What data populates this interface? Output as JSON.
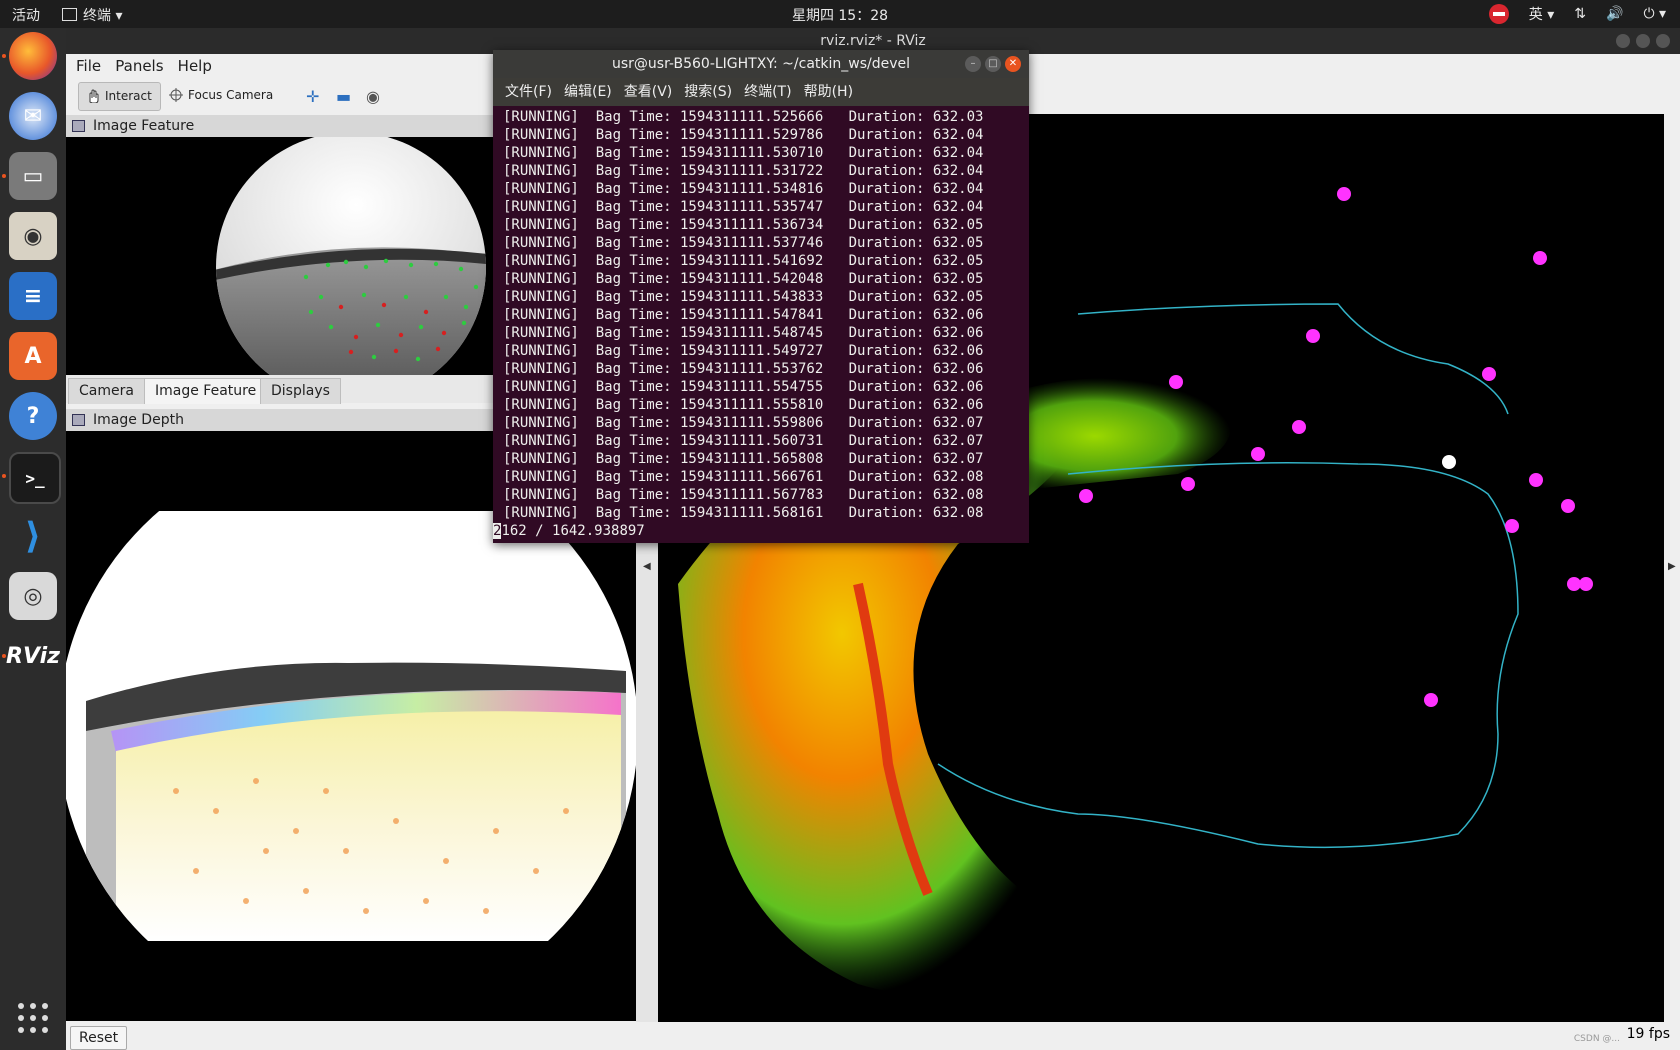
{
  "topbar": {
    "activities": "活动",
    "app": "终端",
    "clock": "星期四 15：28",
    "ime": "英"
  },
  "rviz": {
    "window_title": "rviz.rviz* - RViz",
    "menu": {
      "file": "File",
      "panels": "Panels",
      "help": "Help"
    },
    "toolbar": {
      "interact": "Interact",
      "focus_camera": "Focus Camera"
    },
    "panels": {
      "image_feature": "Image Feature",
      "image_depth": "Image Depth"
    },
    "tabs": [
      "Camera",
      "Image Feature",
      "Displays"
    ],
    "reset": "Reset",
    "fps": "19 fps",
    "watermark": "CSDN @..."
  },
  "terminal": {
    "title": "usr@usr-B560-LIGHTXY: ~/catkin_ws/devel",
    "menu": [
      "文件(F)",
      "编辑(E)",
      "查看(V)",
      "搜索(S)",
      "终端(T)",
      "帮助(H)"
    ],
    "lines": [
      "[RUNNING]  Bag Time: 1594311111.525666   Duration: 632.03",
      "[RUNNING]  Bag Time: 1594311111.529786   Duration: 632.04",
      "[RUNNING]  Bag Time: 1594311111.530710   Duration: 632.04",
      "[RUNNING]  Bag Time: 1594311111.531722   Duration: 632.04",
      "[RUNNING]  Bag Time: 1594311111.534816   Duration: 632.04",
      "[RUNNING]  Bag Time: 1594311111.535747   Duration: 632.04",
      "[RUNNING]  Bag Time: 1594311111.536734   Duration: 632.05",
      "[RUNNING]  Bag Time: 1594311111.537746   Duration: 632.05",
      "[RUNNING]  Bag Time: 1594311111.541692   Duration: 632.05",
      "[RUNNING]  Bag Time: 1594311111.542048   Duration: 632.05",
      "[RUNNING]  Bag Time: 1594311111.543833   Duration: 632.05",
      "[RUNNING]  Bag Time: 1594311111.547841   Duration: 632.06",
      "[RUNNING]  Bag Time: 1594311111.548745   Duration: 632.06",
      "[RUNNING]  Bag Time: 1594311111.549727   Duration: 632.06",
      "[RUNNING]  Bag Time: 1594311111.553762   Duration: 632.06",
      "[RUNNING]  Bag Time: 1594311111.554755   Duration: 632.06",
      "[RUNNING]  Bag Time: 1594311111.555810   Duration: 632.06",
      "[RUNNING]  Bag Time: 1594311111.559806   Duration: 632.07",
      "[RUNNING]  Bag Time: 1594311111.560731   Duration: 632.07",
      "[RUNNING]  Bag Time: 1594311111.565808   Duration: 632.07",
      "[RUNNING]  Bag Time: 1594311111.566761   Duration: 632.08",
      "[RUNNING]  Bag Time: 1594311111.567783   Duration: 632.08",
      "[RUNNING]  Bag Time: 1594311111.568161   Duration: 632.08"
    ],
    "last_line_cursor": "2",
    "last_line_rest": "162 / 1642.938897"
  },
  "dock": [
    "firefox-icon",
    "thunderbird-icon",
    "files-icon",
    "rhythmbox-icon",
    "writer-icon",
    "software-center-icon",
    "help-icon",
    "terminal-icon",
    "vscode-icon",
    "camera-icon",
    "rviz-icon"
  ],
  "colors": {
    "terminal_bg": "#300a24",
    "accent": "#e95420",
    "marker": "#ff33ff",
    "trajectory": "#33b3c7"
  }
}
